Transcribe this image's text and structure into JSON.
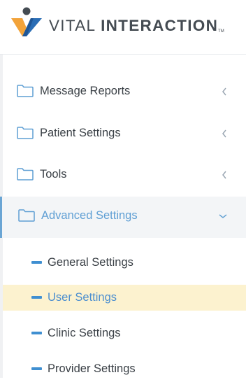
{
  "brand": {
    "name_light": "VITAL ",
    "name_bold": "INTERACTION",
    "trademark": "TM",
    "logo_icon": "vital-interaction-logo"
  },
  "nav": {
    "items": [
      {
        "label": "Message Reports",
        "icon": "folder-icon",
        "chevron": "chevron-left-icon",
        "active": false
      },
      {
        "label": "Patient Settings",
        "icon": "folder-icon",
        "chevron": "chevron-left-icon",
        "active": false
      },
      {
        "label": "Tools",
        "icon": "folder-icon",
        "chevron": "chevron-left-icon",
        "active": false
      },
      {
        "label": "Advanced Settings",
        "icon": "folder-icon",
        "chevron": "chevron-down-icon",
        "active": true
      }
    ],
    "sub_items": [
      {
        "label": "General Settings",
        "selected": false
      },
      {
        "label": "User Settings",
        "selected": true
      },
      {
        "label": "Clinic Settings",
        "selected": false
      },
      {
        "label": "Provider Settings",
        "selected": false
      }
    ]
  },
  "colors": {
    "accent_blue": "#5f9fd4",
    "selected_bg": "#fcf2cf",
    "text": "#3b4147",
    "logo_orange": "#f2a33a",
    "logo_blue": "#2a6db5",
    "logo_dark": "#444b52"
  }
}
